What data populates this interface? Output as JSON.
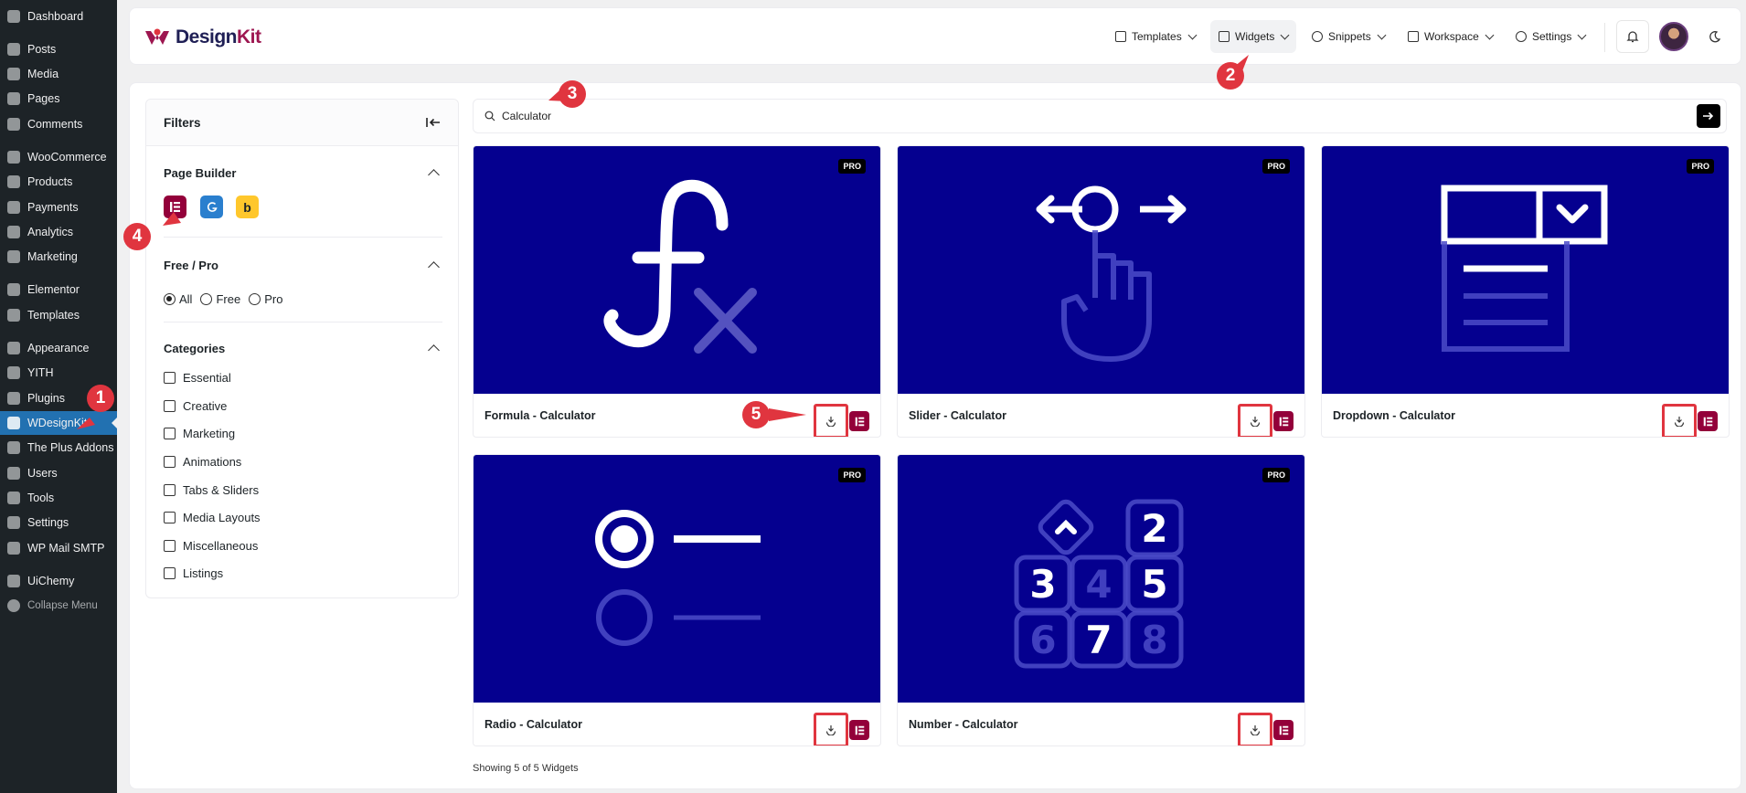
{
  "sidebar": {
    "items": [
      {
        "label": "Dashboard",
        "icon": "dashboard-icon"
      },
      {
        "label": "Posts",
        "icon": "pin-icon"
      },
      {
        "label": "Media",
        "icon": "media-icon"
      },
      {
        "label": "Pages",
        "icon": "pages-icon"
      },
      {
        "label": "Comments",
        "icon": "comment-icon"
      },
      {
        "label": "WooCommerce",
        "icon": "woo-icon"
      },
      {
        "label": "Products",
        "icon": "archive-icon"
      },
      {
        "label": "Payments",
        "icon": "card-icon"
      },
      {
        "label": "Analytics",
        "icon": "chart-icon"
      },
      {
        "label": "Marketing",
        "icon": "megaphone-icon"
      },
      {
        "label": "Elementor",
        "icon": "elementor-icon"
      },
      {
        "label": "Templates",
        "icon": "folder-icon"
      },
      {
        "label": "Appearance",
        "icon": "brush-icon"
      },
      {
        "label": "YITH",
        "icon": "yith-icon"
      },
      {
        "label": "Plugins",
        "icon": "plug-icon"
      },
      {
        "label": "WDesignKit",
        "icon": "designkit-icon"
      },
      {
        "label": "The Plus Addons",
        "icon": "plus-icon"
      },
      {
        "label": "Users",
        "icon": "user-icon"
      },
      {
        "label": "Tools",
        "icon": "wrench-icon"
      },
      {
        "label": "Settings",
        "icon": "settings-icon"
      },
      {
        "label": "WP Mail SMTP",
        "icon": "mail-icon"
      },
      {
        "label": "UiChemy",
        "icon": "uichemy-icon"
      }
    ],
    "collapse_label": "Collapse Menu"
  },
  "header": {
    "brand_prefix": "Design",
    "brand_suffix": "Kit",
    "nav": [
      {
        "label": "Templates",
        "icon": "layout-icon"
      },
      {
        "label": "Widgets",
        "icon": "widget-icon"
      },
      {
        "label": "Snippets",
        "icon": "code-icon"
      },
      {
        "label": "Workspace",
        "icon": "workspace-icon"
      },
      {
        "label": "Settings",
        "icon": "gear-icon"
      }
    ]
  },
  "filters": {
    "title": "Filters",
    "page_builder": {
      "title": "Page Builder",
      "builders": [
        {
          "name": "elementor",
          "color": "#93003a"
        },
        {
          "name": "gutenberg",
          "color": "#2a7fce"
        },
        {
          "name": "bricks",
          "color": "#ffc72c",
          "glyph": "b"
        }
      ]
    },
    "free_pro": {
      "title": "Free / Pro",
      "options": [
        "All",
        "Free",
        "Pro"
      ],
      "selected": "All"
    },
    "categories": {
      "title": "Categories",
      "items": [
        "Essential",
        "Creative",
        "Marketing",
        "Animations",
        "Tabs & Sliders",
        "Media Layouts",
        "Miscellaneous",
        "Listings"
      ]
    }
  },
  "search": {
    "value": "Calculator"
  },
  "cards": [
    {
      "title": "Formula - Calculator",
      "badge": "PRO",
      "art": "formula"
    },
    {
      "title": "Slider - Calculator",
      "badge": "PRO",
      "art": "slider"
    },
    {
      "title": "Dropdown - Calculator",
      "badge": "PRO",
      "art": "dropdown"
    },
    {
      "title": "Radio - Calculator",
      "badge": "PRO",
      "art": "radio"
    },
    {
      "title": "Number - Calculator",
      "badge": "PRO",
      "art": "number"
    }
  ],
  "result_count": "Showing 5 of 5 Widgets",
  "markers": [
    "1",
    "2",
    "3",
    "4",
    "5"
  ],
  "colors": {
    "accent": "#93003a",
    "thumb_bg": "#05008f",
    "marker": "#e0353f",
    "wp_active": "#2271b1",
    "wp_sidebar": "#1d2327"
  }
}
